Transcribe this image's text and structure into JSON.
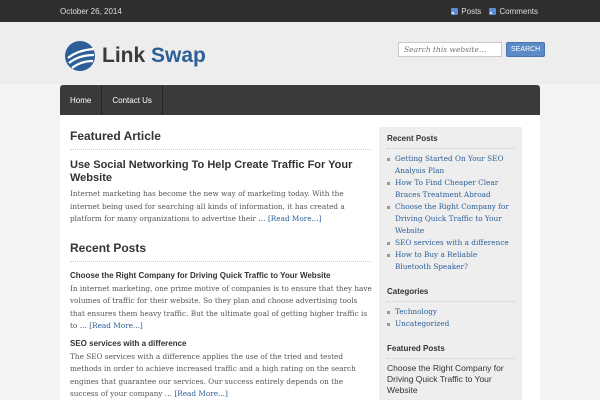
{
  "topbar": {
    "date": "October 26, 2014",
    "posts_feed": "Posts",
    "comments_feed": "Comments"
  },
  "header": {
    "logo_word1": "Link",
    "logo_word2": "Swap",
    "search_placeholder": "Search this website…",
    "search_button": "SEARCH"
  },
  "nav": {
    "items": [
      "Home",
      "Contact Us"
    ]
  },
  "featured": {
    "heading": "Featured Article",
    "title": "Use Social Networking To Help Create Traffic For Your Website",
    "excerpt": "Internet marketing has become the new way of marketing today. With the internet being used for searching all kinds of information, it has created a platform for many organizations to advertise their … ",
    "more": "[Read More...]"
  },
  "recent": {
    "heading": "Recent Posts",
    "posts": [
      {
        "title": "Choose the Right Company for Driving Quick Traffic to Your Website",
        "excerpt": "In internet marketing, one prime motive of companies is to ensure that they have volumes of traffic for their website. So they plan and choose advertising tools that ensures them heavy traffic. But the ultimate goal of getting higher traffic is to … ",
        "more": "[Read More...]"
      },
      {
        "title": "SEO services with a difference",
        "excerpt": "The SEO services with a difference applies the use of the tried and tested methods in order to achieve increased traffic and a high rating on the search engines that guarantee our services. Our success entirely depends on the success of your company … ",
        "more": "[Read More...]"
      }
    ]
  },
  "sidebar": {
    "recent_heading": "Recent Posts",
    "recent_items": [
      "Getting Started On Your SEO Analysis Plan",
      "How To Find Cheaper Clear Braces Treatment Abroad",
      "Choose the Right Company for Driving Quick Traffic to Your Website",
      "SEO services with a difference",
      "How to Buy a Reliable Bluetooth Speaker?"
    ],
    "categories_heading": "Categories",
    "categories": [
      "Technology",
      "Uncategorized"
    ],
    "featured_heading": "Featured Posts",
    "featured_post": "Choose the Right Company for Driving Quick Traffic to Your Website"
  },
  "colors": {
    "accent": "#2c5f98",
    "topbar": "#2f2f2f",
    "nav": "#3a3a3a"
  }
}
